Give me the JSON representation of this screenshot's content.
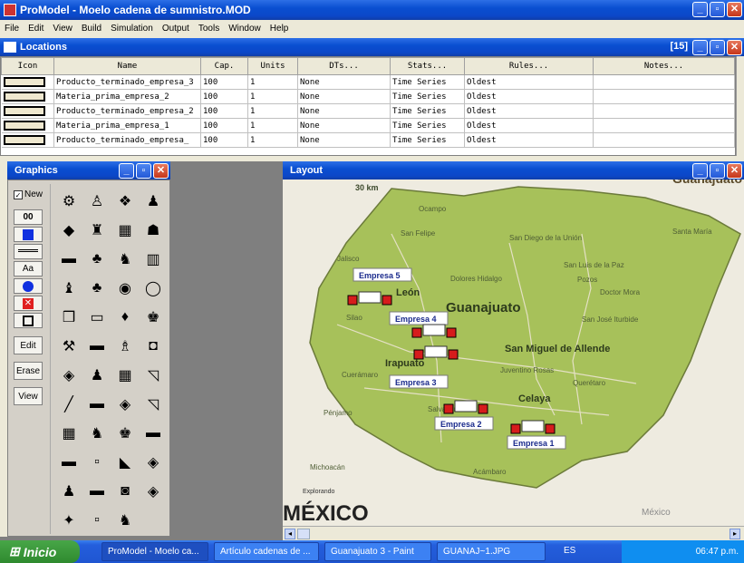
{
  "app": {
    "title": "ProModel - Moelo cadena de sumnistro.MOD"
  },
  "menu": [
    "File",
    "Edit",
    "View",
    "Build",
    "Simulation",
    "Output",
    "Tools",
    "Window",
    "Help"
  ],
  "locations": {
    "title": "Locations",
    "count": "[15]",
    "columns": [
      "Icon",
      "Name",
      "Cap.",
      "Units",
      "DTs...",
      "Stats...",
      "Rules...",
      "Notes..."
    ],
    "rows": [
      {
        "name": "Producto_terminado_empresa_3",
        "cap": "100",
        "units": "1",
        "dts": "None",
        "stats": "Time Series",
        "rules": "Oldest"
      },
      {
        "name": "Materia_prima_empresa_2",
        "cap": "100",
        "units": "1",
        "dts": "None",
        "stats": "Time Series",
        "rules": "Oldest"
      },
      {
        "name": "Producto_terminado_empresa_2",
        "cap": "100",
        "units": "1",
        "dts": "None",
        "stats": "Time Series",
        "rules": "Oldest"
      },
      {
        "name": "Materia_prima_empresa_1",
        "cap": "100",
        "units": "1",
        "dts": "None",
        "stats": "Time Series",
        "rules": "Oldest"
      },
      {
        "name": "Producto_terminado_empresa_",
        "cap": "100",
        "units": "1",
        "dts": "None",
        "stats": "Time Series",
        "rules": "Oldest"
      }
    ]
  },
  "graphics": {
    "title": "Graphics",
    "new_label": "New",
    "buttons": {
      "b00": "00",
      "aa": "Aa",
      "edit": "Edit",
      "erase": "Erase",
      "view": "View"
    }
  },
  "layout": {
    "title": "Layout",
    "map": {
      "scale": "30 km",
      "state": "Guanajuato",
      "state_top": "Guanajuato",
      "country": "MÉXICO",
      "country_small": "México",
      "explorando": "Explorando",
      "cities": [
        "Ocampo",
        "San Felipe",
        "San Diego de la Unión",
        "Santa María",
        "Jalisco",
        "León",
        "San Luis de la Paz",
        "Dolores Hidalgo",
        "Pozos",
        "Doctor Mora",
        "Silao",
        "San José Iturbide",
        "San Miguel de Allende",
        "Irapuato",
        "Juventino Rosas",
        "Querétaro",
        "Cuerámaro",
        "Pénjamo",
        "Salvatierra",
        "Celaya",
        "Michoacán",
        "Acámbaro"
      ],
      "empresas": [
        "Empresa 5",
        "Empresa 4",
        "Empresa 3",
        "Empresa 2",
        "Empresa 1"
      ]
    }
  },
  "taskbar": {
    "start": "Inicio",
    "items": [
      "ProModel - Moelo ca...",
      "Artículo cadenas de ...",
      "Guanajuato 3 - Paint",
      "GUANAJ~1.JPG"
    ],
    "lang": "ES",
    "time": "06:47 p.m."
  },
  "colors": {
    "titlebar": "#0a4fd1",
    "map_land": "#a7c15a",
    "taskbar": "#245edc"
  }
}
